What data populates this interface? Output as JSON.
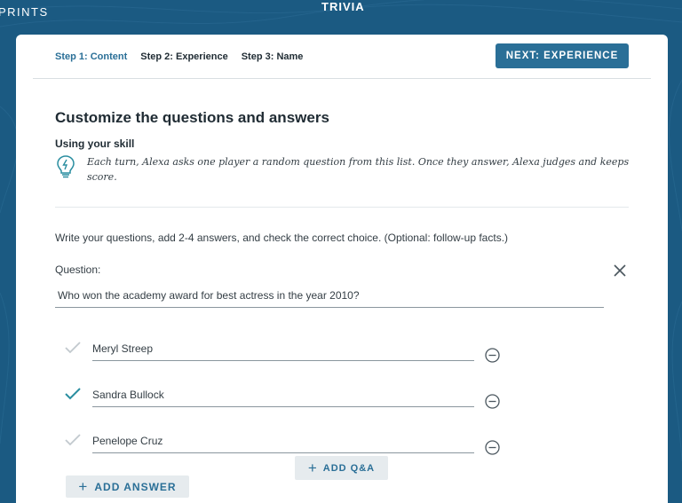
{
  "header": {
    "brand": "PRINTS",
    "title": "TRIVIA"
  },
  "steps": [
    {
      "label": "Step 1: Content",
      "active": true
    },
    {
      "label": "Step 2: Experience",
      "active": false
    },
    {
      "label": "Step 3: Name",
      "active": false
    }
  ],
  "next_button": "NEXT: EXPERIENCE",
  "content": {
    "heading": "Customize the questions and answers",
    "subheading": "Using your skill",
    "tip": "Each turn, Alexa asks one player a random question from this list. Once they answer, Alexa judges and keeps score.",
    "instructions": "Write your questions, add 2-4 answers, and check the correct choice. (Optional: follow-up facts.)"
  },
  "question": {
    "label": "Question:",
    "value": "Who won the academy award for best actress in the year 2010?"
  },
  "answers": [
    {
      "value": "Meryl Streep",
      "correct": false
    },
    {
      "value": "Sandra Bullock",
      "correct": true
    },
    {
      "value": "Penelope Cruz",
      "correct": false
    }
  ],
  "buttons": {
    "add_answer": "ADD ANSWER",
    "add_qa": "ADD Q&A"
  },
  "colors": {
    "background": "#1b5a82",
    "accent": "#2a6f97",
    "check_active": "#2a8ea0",
    "check_inactive": "#c2c9ce"
  },
  "icons": {
    "tip": "lightbulb-icon",
    "close": "close-icon",
    "check": "checkmark-icon",
    "remove": "minus-circle-icon",
    "add": "plus-icon"
  }
}
